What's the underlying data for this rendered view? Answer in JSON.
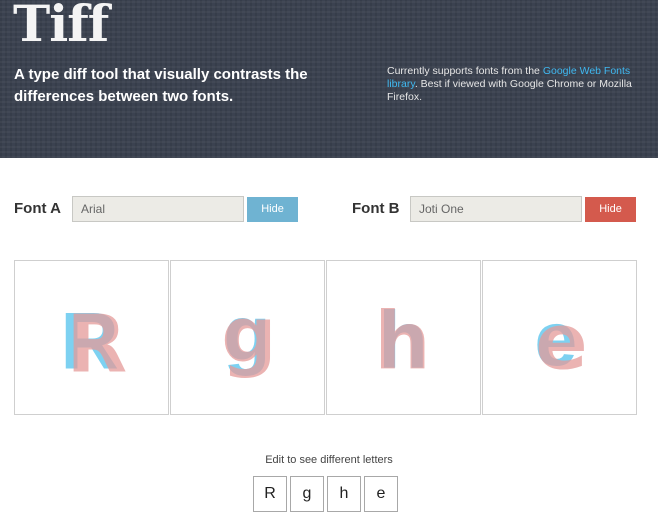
{
  "header": {
    "title": "Tiff",
    "tagline": "A type diff tool that visually contrasts the differences between two fonts.",
    "note_prefix": "Currently supports fonts from the ",
    "note_link": "Google Web Fonts library",
    "note_suffix": ". Best if viewed with Google Chrome or Mozilla Firefox."
  },
  "font_a": {
    "label": "Font A",
    "value": "Arial",
    "button": "Hide",
    "color": "#6fb3d2"
  },
  "font_b": {
    "label": "Font B",
    "value": "Joti One",
    "button": "Hide",
    "color": "#d45a4d"
  },
  "overlay_colors": {
    "font_a": "#5cc6ee",
    "font_b": "#e49a98"
  },
  "letters": [
    "R",
    "g",
    "h",
    "e"
  ],
  "hint": "Edit to see different letters"
}
